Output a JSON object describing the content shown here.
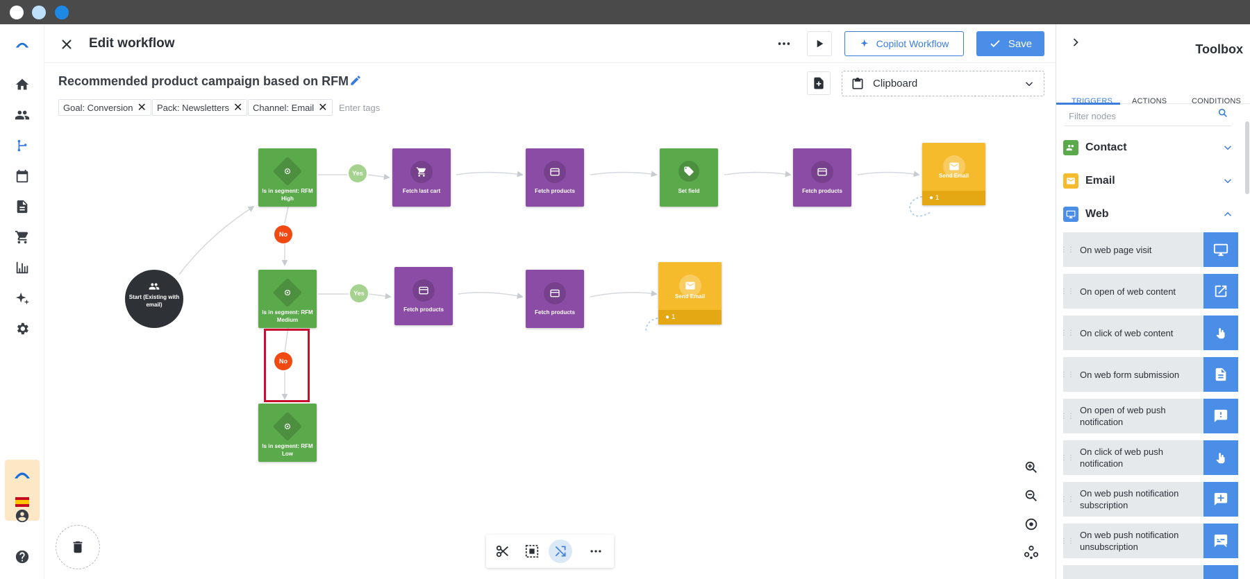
{
  "header": {
    "title": "Edit workflow",
    "copilot_label": "Copilot Workflow",
    "save_label": "Save"
  },
  "workflow": {
    "name": "Recommended product campaign based on RFM",
    "tags": [
      "Goal: Conversion",
      "Pack: Newsletters",
      "Channel: Email"
    ],
    "tags_placeholder": "Enter tags",
    "clipboard_label": "Clipboard"
  },
  "nodes": {
    "start": "Start (Existing with email)",
    "seg_high": "Is in segment: RFM High",
    "seg_medium": "Is in segment: RFM Medium",
    "seg_low": "Is in segment: RFM Low",
    "fetch_last_cart": "Fetch last cart",
    "fetch_products": "Fetch products",
    "set_field": "Set field",
    "send_email": "Send Email",
    "email_count": "1",
    "yes": "Yes",
    "no": "No"
  },
  "toolbox": {
    "title": "Toolbox",
    "tabs": [
      "TRIGGERS",
      "ACTIONS",
      "CONDITIONS"
    ],
    "search_placeholder": "Filter nodes",
    "categories": [
      "Contact",
      "Email",
      "Web"
    ],
    "items": [
      "On web page visit",
      "On open of web content",
      "On click of web content",
      "On web form submission",
      "On open of web push notification",
      "On click of web push notification",
      "On web push notification subscription",
      "On web push notification unsubscription"
    ],
    "colors": {
      "contact": "#5aa94a",
      "email": "#f6bb2d",
      "web": "#4a8ee8"
    }
  }
}
